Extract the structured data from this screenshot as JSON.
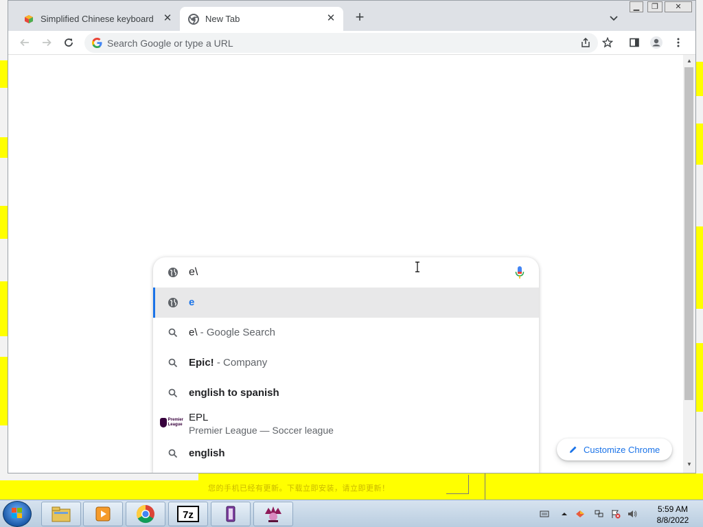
{
  "tabs": [
    {
      "title": "Simplified Chinese keyboard",
      "icon": "app-favicon-icon",
      "active": false
    },
    {
      "title": "New Tab",
      "icon": "chrome-icon",
      "active": true
    }
  ],
  "toolbar": {
    "omnibox_placeholder": "Search Google or type a URL"
  },
  "realbox": {
    "query": "e\\",
    "suggestions": [
      {
        "icon": "globe-icon",
        "text": "e",
        "selected": true
      },
      {
        "icon": "search-icon",
        "bold": "e\\",
        "dim": " - Google Search"
      },
      {
        "icon": "search-icon",
        "bold": "Epic!",
        "dim": " - Company"
      },
      {
        "icon": "search-icon",
        "bold": "english to spanish"
      },
      {
        "icon": "premier-league-logo",
        "line1": "EPL",
        "line2": "Premier League — Soccer league"
      },
      {
        "icon": "search-icon",
        "bold": "english"
      }
    ]
  },
  "customize": {
    "label": "Customize Chrome"
  },
  "banner": {
    "text": "您的手机已经有更新。下载立即安装，请立即更新！"
  },
  "taskbar": {
    "apps": [
      "file-explorer-icon",
      "media-player-icon",
      "chrome-icon",
      "7zip-icon",
      "installer-icon",
      "game-icon"
    ],
    "time": "5:59 AM",
    "date": "8/8/2022"
  },
  "colors": {
    "accent": "#1a73e8",
    "desktop_yellow": "#ffff00"
  }
}
